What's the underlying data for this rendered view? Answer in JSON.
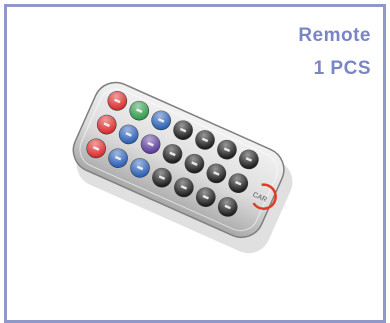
{
  "caption": {
    "title": "Remote",
    "quantity": "1 PCS"
  },
  "product": {
    "kind": "infrared remote control",
    "body_color": "#dcdcdc",
    "button_colors": [
      "#d92b2b",
      "#2f9a4a",
      "#2b5fb5",
      "#5b3c9c",
      "#1c1c1c"
    ],
    "button_grid": "3 rows x 7 columns"
  }
}
